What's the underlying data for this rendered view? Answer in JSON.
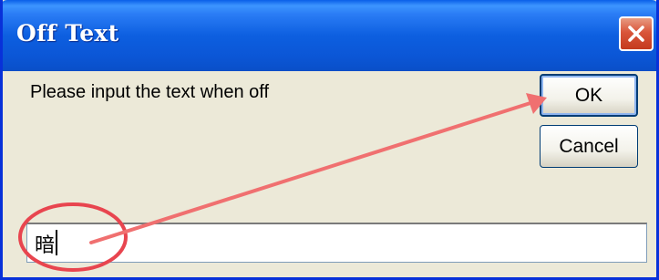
{
  "window": {
    "title": "Off Text",
    "close_icon": "close-icon"
  },
  "dialog": {
    "prompt": "Please input the text when off",
    "ok_label": "OK",
    "cancel_label": "Cancel",
    "input_value": "暗"
  },
  "annotation": {
    "color": "#e8454f",
    "arrow_color": "#f07070"
  },
  "colors": {
    "titlebar": "#0b56d6",
    "window_bg": "#ece9d8",
    "close_button": "#d9553a"
  }
}
